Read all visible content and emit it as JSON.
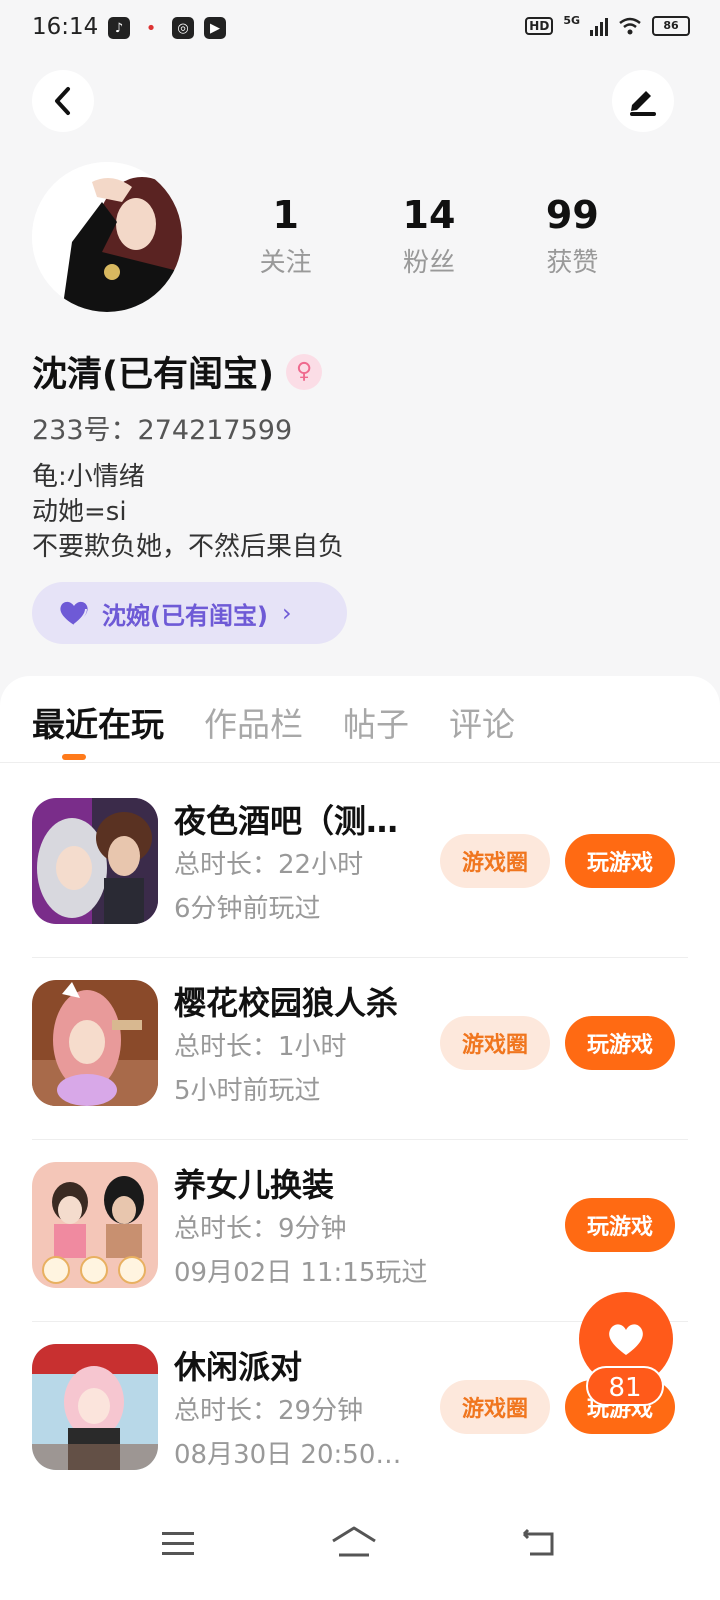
{
  "status_bar": {
    "time": "16:14",
    "network": "5G",
    "hd": "HD",
    "battery": "86"
  },
  "profile": {
    "name": "沈清(已有闺宝)",
    "gender_icon": "female-icon",
    "uid": "233号：274217599",
    "bio": [
      "龟:小情绪",
      "动她=si",
      "不要欺负她，不然后果自负"
    ],
    "partner": {
      "label": "沈婉(已有闺宝)",
      "chevron": "›",
      "icon": "heart-icon"
    },
    "stats": [
      {
        "num": "1",
        "label": "关注"
      },
      {
        "num": "14",
        "label": "粉丝"
      },
      {
        "num": "99",
        "label": "获赞"
      }
    ]
  },
  "tabs": [
    {
      "label": "最近在玩",
      "active": true
    },
    {
      "label": "作品栏",
      "active": false
    },
    {
      "label": "帖子",
      "active": false
    },
    {
      "label": "评论",
      "active": false
    }
  ],
  "games": [
    {
      "title": "夜色酒吧（测…",
      "time": "总时长：22小时",
      "last": "6分钟前玩过",
      "circle_label": "游戏圈",
      "play_label": "玩游戏",
      "has_circle": true
    },
    {
      "title": "樱花校园狼人杀",
      "time": "总时长：1小时",
      "last": "5小时前玩过",
      "circle_label": "游戏圈",
      "play_label": "玩游戏",
      "has_circle": true
    },
    {
      "title": "养女儿换装",
      "time": "总时长：9分钟",
      "last": "09月02日 11:15玩过",
      "circle_label": "",
      "play_label": "玩游戏",
      "has_circle": false
    },
    {
      "title": "休闲派对",
      "time": "总时长：29分钟",
      "last": "08月30日 20:50…",
      "circle_label": "游戏圈",
      "play_label": "玩游戏",
      "has_circle": true
    }
  ],
  "fab": {
    "count": "81"
  },
  "colors": {
    "accent": "#ff6a13",
    "partner": "#6e5ad6",
    "bg": "#f6f6f7"
  }
}
